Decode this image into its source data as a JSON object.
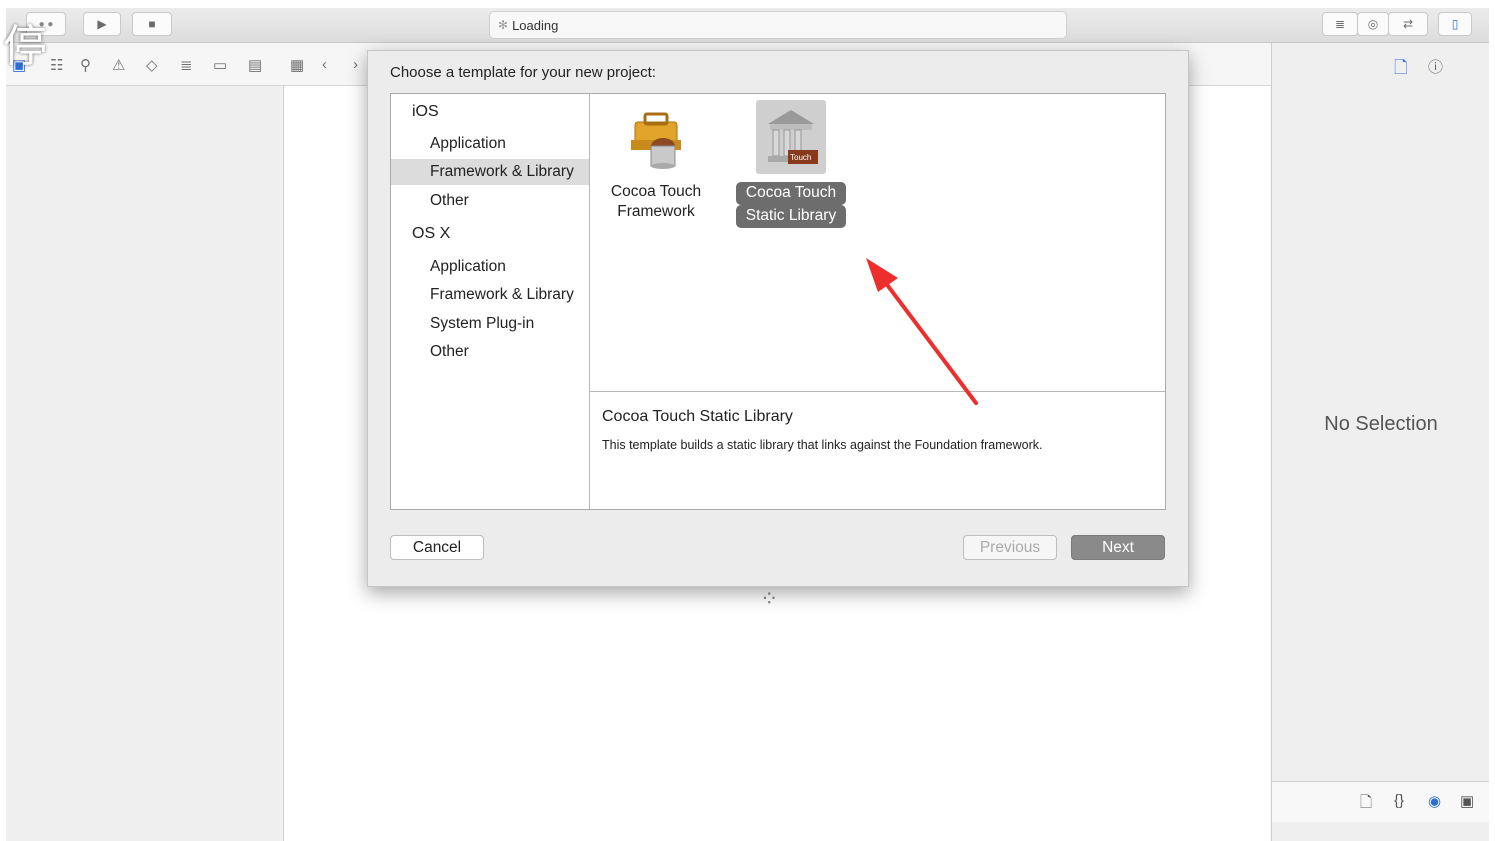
{
  "toolbar": {
    "activity_text": "Loading",
    "run_icon": "play-icon",
    "stop_icon": "stop-icon"
  },
  "watermark": "停",
  "dialog": {
    "title": "Choose a template for your new project:",
    "categories": [
      {
        "heading": "iOS",
        "items": [
          {
            "label": "Application",
            "selected": false
          },
          {
            "label": "Framework & Library",
            "selected": true
          },
          {
            "label": "Other",
            "selected": false
          }
        ]
      },
      {
        "heading": "OS X",
        "items": [
          {
            "label": "Application",
            "selected": false
          },
          {
            "label": "Framework & Library",
            "selected": false
          },
          {
            "label": "System Plug-in",
            "selected": false
          },
          {
            "label": "Other",
            "selected": false
          }
        ]
      }
    ],
    "templates": [
      {
        "line1": "Cocoa Touch",
        "line2": "Framework",
        "icon": "toolbox-icon",
        "selected": false
      },
      {
        "line1": "Cocoa Touch",
        "line2": "Static Library",
        "icon": "library-building-icon",
        "icon_badge": "Touch",
        "selected": true
      }
    ],
    "description": {
      "title": "Cocoa Touch Static Library",
      "text": "This template builds a static library that links against the Foundation framework."
    },
    "buttons": {
      "cancel": "Cancel",
      "previous": "Previous",
      "next": "Next"
    }
  },
  "inspector": {
    "no_selection": "No Selection"
  },
  "annotation": {
    "color": "#ee2d2d"
  }
}
